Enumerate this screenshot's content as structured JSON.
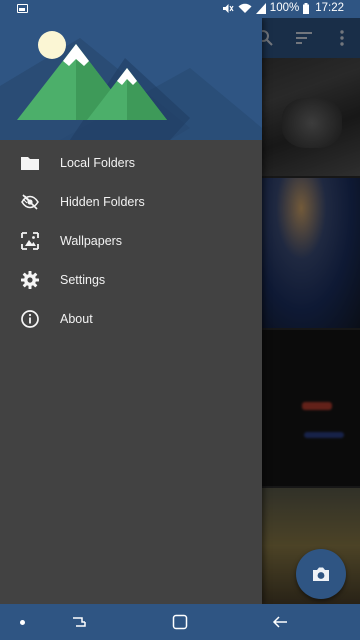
{
  "status_bar": {
    "battery": "100%",
    "time": "17:22"
  },
  "drawer": {
    "menu": [
      {
        "label": "Local Folders",
        "icon": "folder-icon"
      },
      {
        "label": "Hidden Folders",
        "icon": "hidden-eye-icon"
      },
      {
        "label": "Wallpapers",
        "icon": "wallpaper-icon"
      },
      {
        "label": "Settings",
        "icon": "gear-icon"
      },
      {
        "label": "About",
        "icon": "info-icon"
      }
    ]
  },
  "colors": {
    "primary": "#2f5583",
    "drawer_bg": "#424242",
    "mountain_green": "#4caf6a"
  }
}
